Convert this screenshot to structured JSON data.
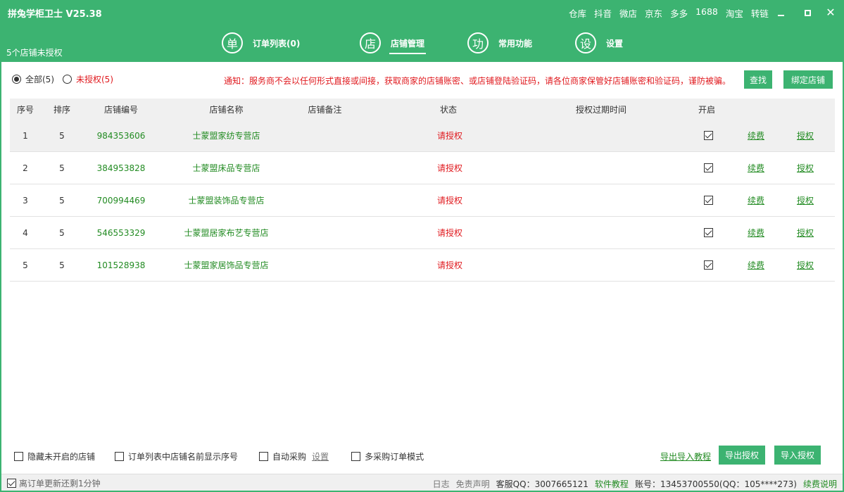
{
  "app": {
    "title": "拼兔学柜卫士 V25.38",
    "unauthorized_status": "5个店铺未授权"
  },
  "top_links": [
    "仓库",
    "抖音",
    "微店",
    "京东",
    "多多",
    "1688",
    "淘宝",
    "转链"
  ],
  "window_controls": {
    "minimize": "minimize-icon",
    "maximize": "maximize-icon",
    "close": "✕"
  },
  "nav": [
    {
      "icon_char": "单",
      "label": "订单列表(0)",
      "active": false
    },
    {
      "icon_char": "店",
      "label": "店铺管理",
      "active": true
    },
    {
      "icon_char": "功",
      "label": "常用功能",
      "active": false
    },
    {
      "icon_char": "设",
      "label": "设置",
      "active": false
    }
  ],
  "filter": {
    "all_label": "全部(5)",
    "unauth_label": "未授权(5)",
    "selected": "all"
  },
  "notice": "通知：服务商不会以任何形式直接或间接，获取商家的店铺账密、或店铺登陆验证码，请各位商家保管好店铺账密和验证码，谨防被骗。",
  "buttons": {
    "search": "查找",
    "bind_store": "绑定店铺",
    "export_tutorial": "导出导入教程",
    "export_auth": "导出授权",
    "import_auth": "导入授权"
  },
  "table": {
    "headers": [
      "序号",
      "排序",
      "店铺编号",
      "店铺名称",
      "店铺备注",
      "状态",
      "授权过期时间",
      "开启"
    ],
    "rows": [
      {
        "index": "1",
        "sort": "5",
        "id": "984353606",
        "name": "士蒙盟家纺专营店",
        "note": "",
        "status": "请授权",
        "expire": "",
        "enabled": true,
        "renew": "续费",
        "auth": "授权"
      },
      {
        "index": "2",
        "sort": "5",
        "id": "384953828",
        "name": "士蒙盟床品专营店",
        "note": "",
        "status": "请授权",
        "expire": "",
        "enabled": true,
        "renew": "续费",
        "auth": "授权"
      },
      {
        "index": "3",
        "sort": "5",
        "id": "700994469",
        "name": "士蒙盟装饰品专营店",
        "note": "",
        "status": "请授权",
        "expire": "",
        "enabled": true,
        "renew": "续费",
        "auth": "授权"
      },
      {
        "index": "4",
        "sort": "5",
        "id": "546553329",
        "name": "士蒙盟居家布艺专营店",
        "note": "",
        "status": "请授权",
        "expire": "",
        "enabled": true,
        "renew": "续费",
        "auth": "授权"
      },
      {
        "index": "5",
        "sort": "5",
        "id": "101528938",
        "name": "士蒙盟家居饰品专营店",
        "note": "",
        "status": "请授权",
        "expire": "",
        "enabled": true,
        "renew": "续费",
        "auth": "授权"
      }
    ]
  },
  "options": {
    "hide_disabled": {
      "label": "隐藏未开启的店铺",
      "checked": false
    },
    "show_index": {
      "label": "订单列表中店铺名前显示序号",
      "checked": false
    },
    "auto_purchase": {
      "label": "自动采购",
      "checked": false,
      "settings_link": "设置"
    },
    "multi_purchase": {
      "label": "多采购订单模式",
      "checked": false
    }
  },
  "statusbar": {
    "refresh_label": "离订单更新还剩1分钟",
    "refresh_checked": true,
    "log": "日志",
    "disclaimer": "免责声明",
    "support_qq": "客服QQ：3007665121",
    "tutorial": "软件教程",
    "account": "账号：13453700550(QQ：105****273)",
    "renew_info": "续费说明"
  },
  "colors": {
    "brand_green": "#3cb371",
    "link_green": "#228b22",
    "alert_red": "#e0191e"
  }
}
